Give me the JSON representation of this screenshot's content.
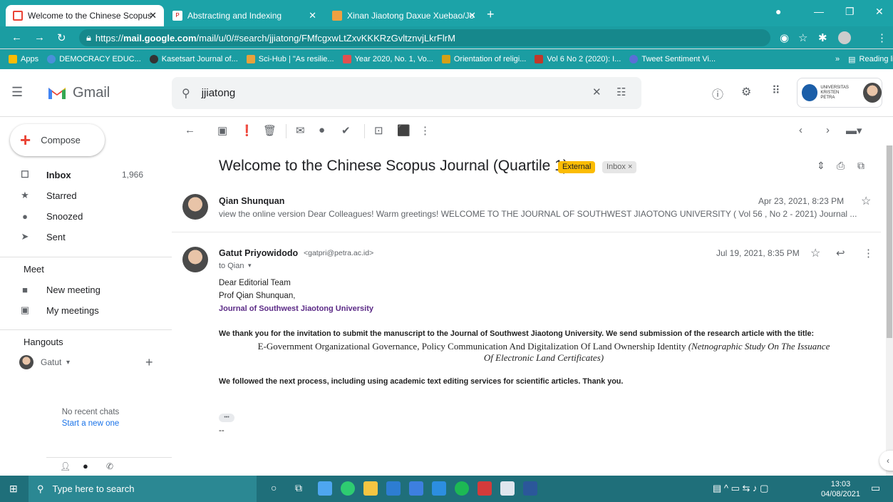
{
  "browser": {
    "tabs": [
      {
        "title": "Welcome to the Chinese Scopus",
        "favicon": "gmail-icon",
        "active": true
      },
      {
        "title": "Abstracting and Indexing",
        "favicon": "pkp-icon",
        "active": false
      },
      {
        "title": "Xinan Jiaotong Daxue Xuebao/Jo",
        "favicon": "sjr-icon",
        "active": false
      }
    ],
    "url_prefix": "https://",
    "url_host": "mail.google.com",
    "url_path": "/mail/u/0/#search/jjiatong/FMfcgxwLtZxvKKKRzGvltznvjLkrFlrM",
    "bookmarks": [
      "Apps",
      "DEMOCRACY EDUC...",
      "Kasetsart Journal of...",
      "Sci-Hub | \"As resilie...",
      "Year 2020, No. 1, Vo...",
      "Orientation of religi...",
      "Vol 6 No 2 (2020): I...",
      "Tweet Sentiment Vi..."
    ],
    "reading_list": "Reading list"
  },
  "gmail": {
    "logo_text": "Gmail",
    "search_value": "jjiatong",
    "org_name": "UNIVERSITAS KRISTEN PETRA"
  },
  "sidebar": {
    "compose": "Compose",
    "items": [
      {
        "label": "Inbox",
        "count": "1,966",
        "icon": "inbox-icon"
      },
      {
        "label": "Starred",
        "count": "",
        "icon": "star-icon"
      },
      {
        "label": "Snoozed",
        "count": "",
        "icon": "clock-icon"
      },
      {
        "label": "Sent",
        "count": "",
        "icon": "send-icon"
      }
    ],
    "meet_heading": "Meet",
    "meet_items": [
      "New meeting",
      "My meetings"
    ],
    "hangouts_heading": "Hangouts",
    "hangouts_user": "Gatut",
    "no_chats": "No recent chats",
    "start_new": "Start a new one"
  },
  "thread": {
    "subject": "Welcome to the Chinese Scopus Journal (Quartile 1)",
    "label_external": "External",
    "label_inbox": "Inbox ×",
    "messages": [
      {
        "sender": "Qian Shunquan",
        "date": "Apr 23, 2021, 8:23 PM",
        "snippet": "view the online version Dear Colleagues! Warm greetings! WELCOME TO THE JOURNAL OF SOUTHWEST JIAOTONG UNIVERSITY ( Vol 56 , No 2 - 2021) Journal ..."
      },
      {
        "sender": "Gatut Priyowidodo",
        "email": "<gatpri@petra.ac.id>",
        "date": "Jul 19, 2021, 8:35 PM",
        "to": "to Qian",
        "greeting1": "Dear Editorial Team",
        "greeting2": "Prof Qian Shunquan,",
        "journal": "Journal of Southwest Jiaotong University",
        "para1": "We  thank you for the invitation to submit the manuscript to the Journal of Southwest Jiaotong University. We send submission of the research article with the title:",
        "title_line1": "E-Government Organizational Governance, Policy Communication And Digitalization Of Land Ownership Identity",
        "title_italic1": "(Netnographic Study On The Issuance",
        "title_italic2": "Of Electronic Land Certificates)",
        "para2": "We followed the next process, including using academic text editing services for scientific articles. Thank you.",
        "ellipsis": "•••",
        "sig": "--"
      }
    ]
  },
  "taskbar": {
    "search_placeholder": "Type here to search",
    "time": "13:03",
    "date": "04/08/2021"
  },
  "colors": {
    "chrome_accent": "#1ca3a8",
    "gmail_red": "#ea4335",
    "external_badge": "#fbbc04",
    "taskbar": "#1f6f7a"
  }
}
